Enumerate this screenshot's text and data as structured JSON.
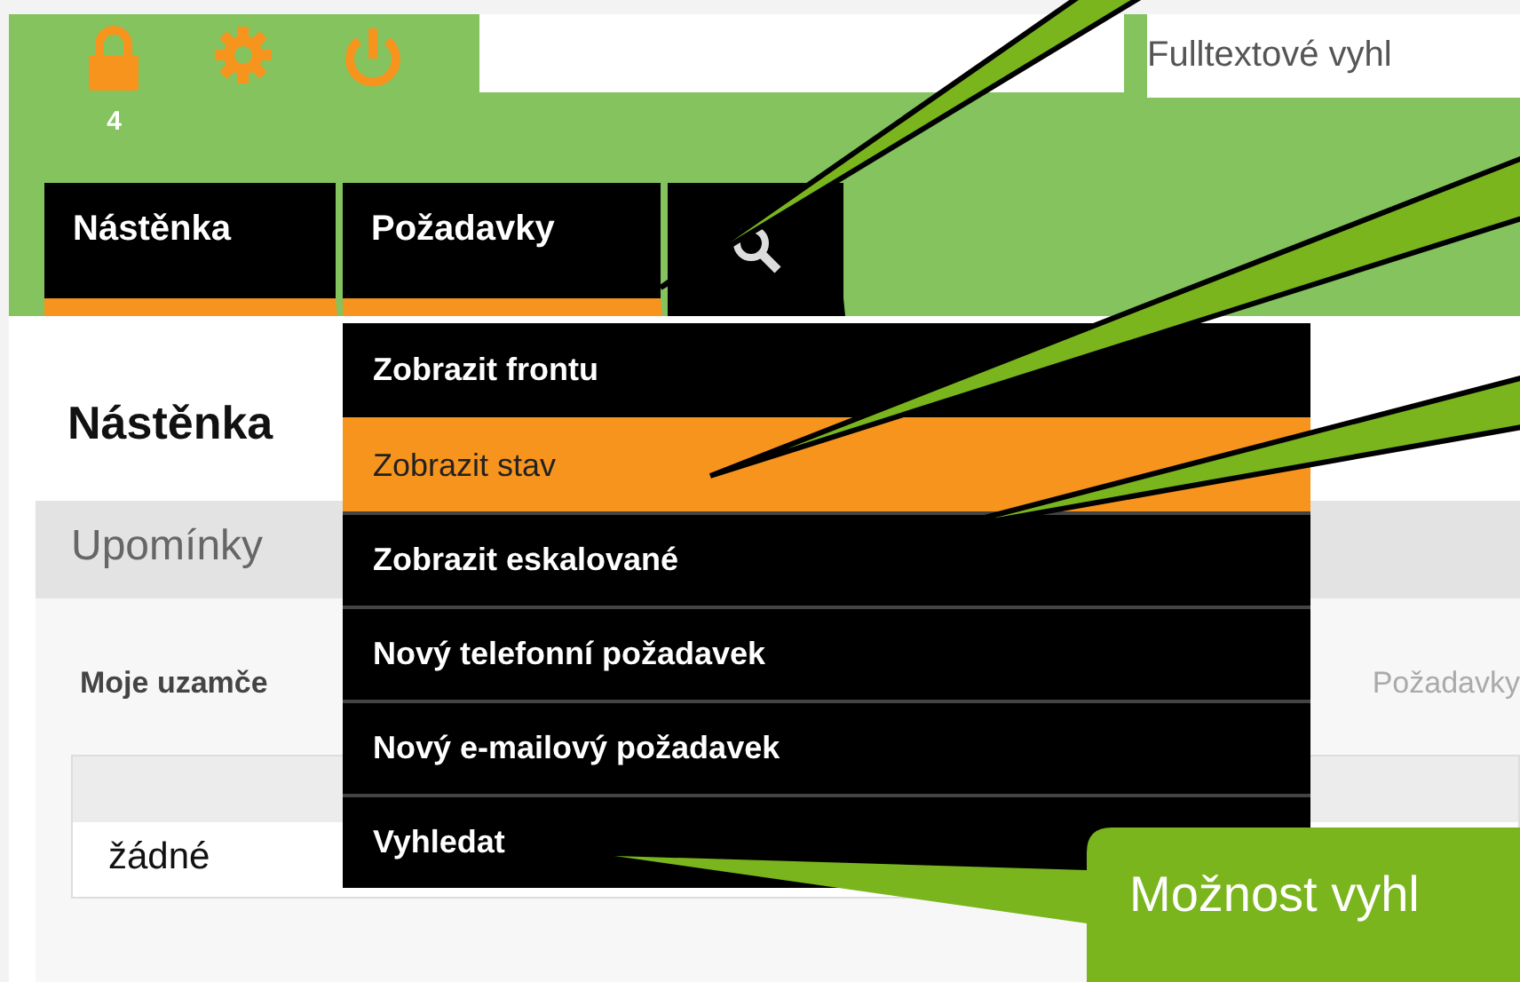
{
  "toolbar": {
    "lock_count": "4",
    "fulltext_search": {
      "placeholder": "Fulltextové vyhl"
    }
  },
  "nav_tabs": [
    {
      "kind": "text",
      "label": "Nástěnka",
      "underlined": true
    },
    {
      "kind": "text",
      "label": "Požadavky",
      "underlined": true
    },
    {
      "kind": "search",
      "underlined": false
    }
  ],
  "dropdown": [
    {
      "label": "Zobrazit frontu",
      "selected": false
    },
    {
      "label": "Zobrazit stav",
      "selected": true
    },
    {
      "label": "Zobrazit eskalované",
      "selected": false
    },
    {
      "label": "Nový telefonní požadavek",
      "selected": false
    },
    {
      "label": "Nový e-mailový požadavek",
      "selected": false
    },
    {
      "label": "Vyhledat",
      "selected": false
    }
  ],
  "page_title": "Nástěnka",
  "panel": {
    "title": "Upomínky",
    "section_label": "Moje uzamče",
    "section_link": "Požadavky",
    "table_rows": [
      "žádné"
    ]
  },
  "callout": {
    "text": "Možnost vyhl"
  }
}
